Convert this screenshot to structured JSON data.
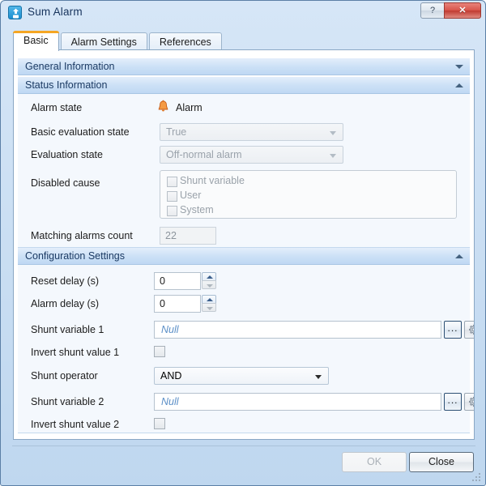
{
  "window": {
    "title": "Sum Alarm",
    "icon": "app-alarm-icon",
    "help_label": "?",
    "close_label": "✕"
  },
  "tabs": [
    {
      "label": "Basic",
      "active": true
    },
    {
      "label": "Alarm Settings",
      "active": false
    },
    {
      "label": "References",
      "active": false
    }
  ],
  "sections": {
    "general": {
      "title": "General Information",
      "expanded": false,
      "chevron": "chevron-down-icon"
    },
    "status": {
      "title": "Status Information",
      "expanded": true,
      "chevron": "chevron-up-icon"
    },
    "configuration": {
      "title": "Configuration Settings",
      "expanded": true,
      "chevron": "chevron-up-icon"
    }
  },
  "status_information": {
    "alarm_state": {
      "label": "Alarm state",
      "icon": "bell-icon",
      "value": "Alarm"
    },
    "basic_evaluation_state": {
      "label": "Basic evaluation state",
      "value": "True",
      "enabled": false
    },
    "evaluation_state": {
      "label": "Evaluation state",
      "value": "Off-normal alarm",
      "enabled": false
    },
    "disabled_cause": {
      "label": "Disabled cause",
      "options": [
        {
          "label": "Shunt variable",
          "checked": false
        },
        {
          "label": "User",
          "checked": false
        },
        {
          "label": "System",
          "checked": false
        }
      ]
    },
    "matching_alarms_count": {
      "label": "Matching alarms count",
      "value": "22",
      "enabled": false
    }
  },
  "configuration_settings": {
    "reset_delay": {
      "label": "Reset delay (s)",
      "value": "0"
    },
    "alarm_delay": {
      "label": "Alarm delay (s)",
      "value": "0"
    },
    "shunt_variable_1": {
      "label": "Shunt variable 1",
      "value": "Null",
      "browse_label": "...",
      "settings_icon": "gear-icon"
    },
    "invert_shunt_value_1": {
      "label": "Invert shunt value 1",
      "checked": false
    },
    "shunt_operator": {
      "label": "Shunt operator",
      "value": "AND"
    },
    "shunt_variable_2": {
      "label": "Shunt variable 2",
      "value": "Null",
      "browse_label": "...",
      "settings_icon": "gear-icon"
    },
    "invert_shunt_value_2": {
      "label": "Invert shunt value 2",
      "checked": false
    }
  },
  "footer": {
    "ok_label": "OK",
    "close_label": "Close"
  },
  "colors": {
    "accent_tab": "#f5a623",
    "section_header": "#cbe0f6",
    "alarm_icon": "#ef7b21",
    "null_text": "#5b8fc7",
    "close_button": "#d9564c"
  }
}
